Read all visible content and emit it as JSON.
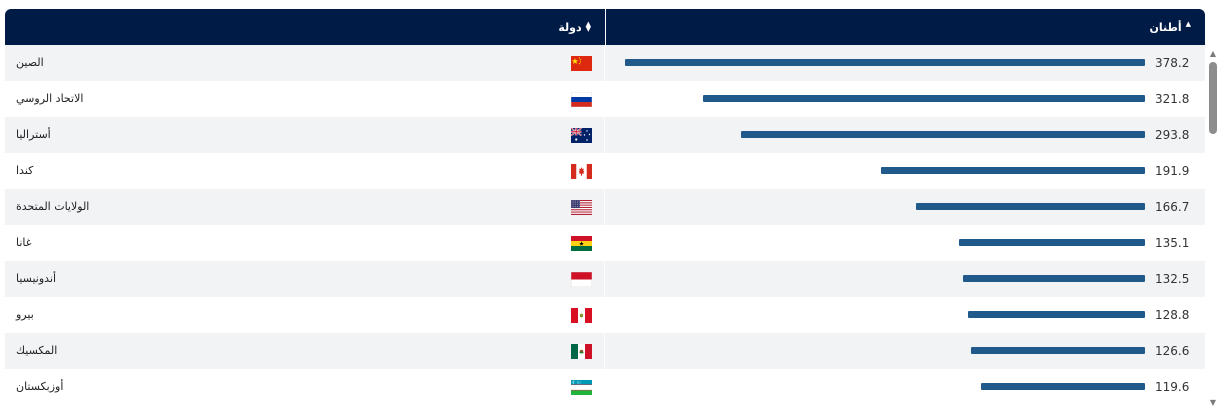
{
  "chart_data": {
    "type": "bar",
    "orientation": "horizontal",
    "headers": {
      "country": "دولة",
      "value": "أطنان"
    },
    "categories": [
      "الصين",
      "الاتحاد الروسي",
      "أستراليا",
      "كندا",
      "الولايات المتحدة",
      "غانا",
      "أندونيسيا",
      "بيرو",
      "المكسيك",
      "أوزبكستان"
    ],
    "values": [
      378.2,
      321.8,
      293.8,
      191.9,
      166.7,
      135.1,
      132.5,
      128.8,
      126.6,
      119.6
    ],
    "value_labels": [
      "378.2",
      "321.8",
      "293.8",
      "191.9",
      "166.7",
      "135.1",
      "132.5",
      "128.8",
      "126.6",
      "119.6"
    ],
    "flags": [
      "china-flag-icon",
      "russia-flag-icon",
      "australia-flag-icon",
      "canada-flag-icon",
      "usa-flag-icon",
      "ghana-flag-icon",
      "indonesia-flag-icon",
      "peru-flag-icon",
      "mexico-flag-icon",
      "uzbekistan-flag-icon"
    ],
    "bar_color": "#1f5a8a",
    "header_color": "#011b47"
  }
}
